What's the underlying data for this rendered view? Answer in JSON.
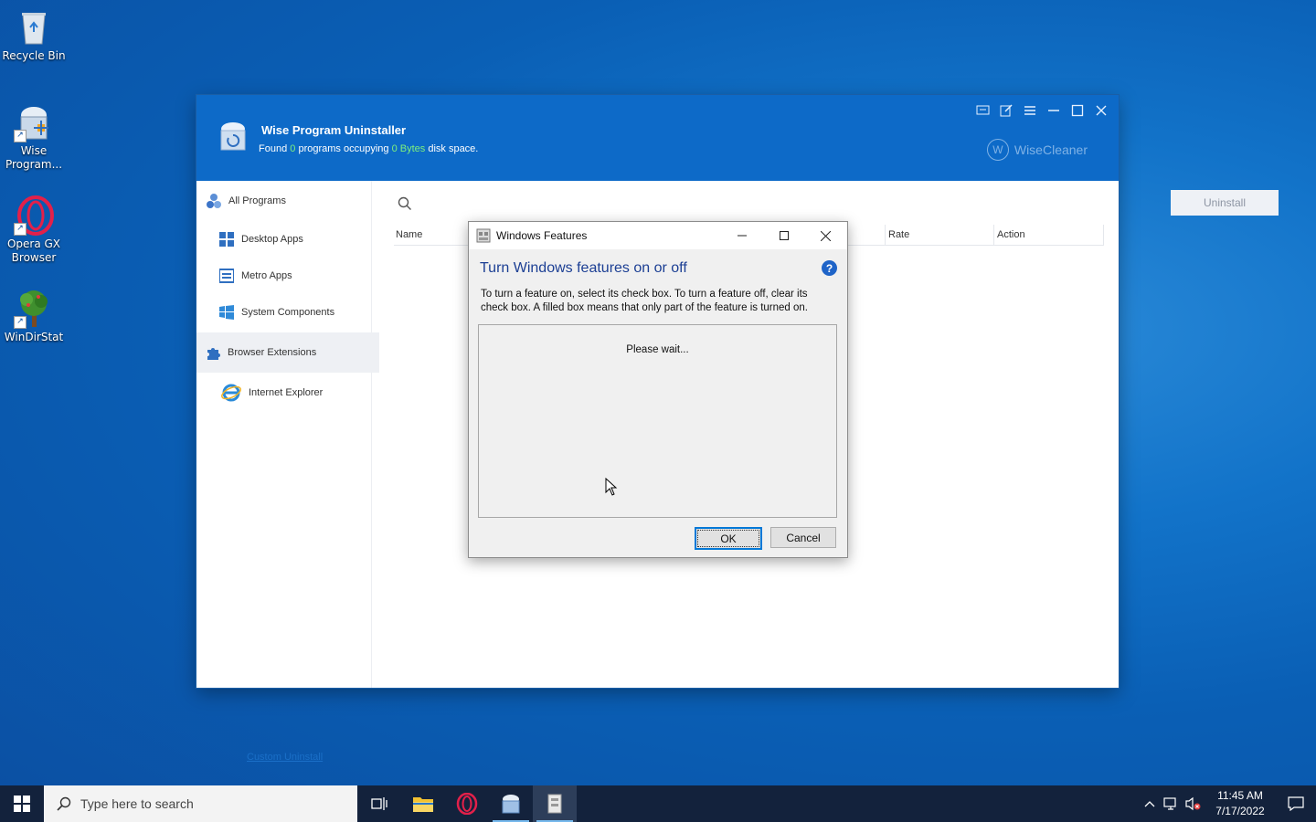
{
  "desktop": {
    "icons": [
      {
        "label": "Recycle Bin"
      },
      {
        "label": "Wise Program..."
      },
      {
        "label": "Opera GX Browser"
      },
      {
        "label": "WinDirStat"
      }
    ]
  },
  "app": {
    "title": "Wise Program Uninstaller",
    "subtitle": {
      "prefix": "Found",
      "count": "0",
      "middle": "programs occupying",
      "size": "0 Bytes",
      "suffix": "disk space."
    },
    "brand": "WiseCleaner",
    "brand_letter": "W",
    "nav": [
      {
        "label": "All Programs"
      },
      {
        "label": "Desktop Apps"
      },
      {
        "label": "Metro Apps"
      },
      {
        "label": "System Components"
      },
      {
        "label": "Browser Extensions"
      },
      {
        "label": "Internet Explorer"
      }
    ],
    "custom_uninstall": "Custom Uninstall",
    "uninstall_label": "Uninstall",
    "columns": {
      "name": "Name",
      "rate": "Rate",
      "action": "Action"
    }
  },
  "dialog": {
    "title": "Windows Features",
    "heading": "Turn Windows features on or off",
    "description": "To turn a feature on, select its check box. To turn a feature off, clear its check box. A filled box means that only part of the feature is turned on.",
    "status": "Please wait...",
    "ok_label": "OK",
    "cancel_label": "Cancel",
    "help_glyph": "?"
  },
  "taskbar": {
    "search_placeholder": "Type here to search",
    "time": "11:45 AM",
    "date": "7/17/2022"
  },
  "colors": {
    "header_blue": "#0d6ac8",
    "dialog_heading": "#1c3f94",
    "highlight_green": "#7df07d"
  }
}
